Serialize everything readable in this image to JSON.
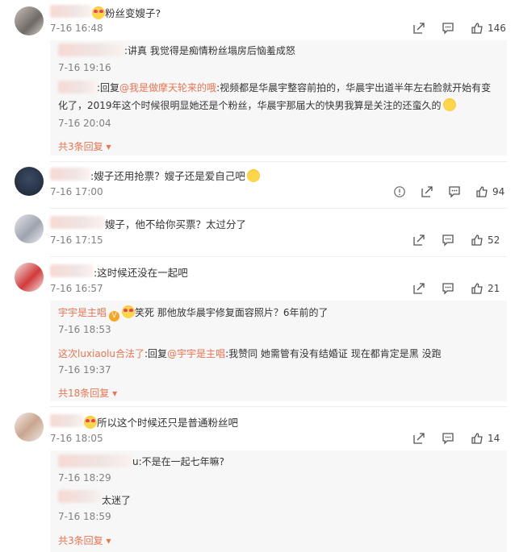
{
  "comments": [
    {
      "text": "粉丝变嫂子?",
      "time": "7-16 16:48",
      "likes": "146",
      "replies": [
        {
          "text": ":讲真 我觉得是痴情粉丝塌房后恼羞成怒",
          "time": "7-16 19:16"
        },
        {
          "prefix": ":回复",
          "mention": "@我是做摩天轮来的哦",
          "text_line1": ":视频都是华晨宇整容前拍的，华晨宇出道半年左右脸就开始有变",
          "text_line2": "化了，2019年这个时候很明显她还是个粉丝，华晨宇那届大的快男我算是关注的还蛮久的",
          "time": "7-16 20:04"
        }
      ],
      "more": "共3条回复"
    },
    {
      "text": ":嫂子还用抢票？嫂子还是爱自己吧",
      "time": "7-16 17:00",
      "likes": "94"
    },
    {
      "text": "嫂子，他不给你买票？太过分了",
      "time": "7-16 17:15",
      "likes": "52"
    },
    {
      "text": ":这时候还没在一起吧",
      "time": "7-16 16:57",
      "likes": "21",
      "replies": [
        {
          "user": "宇宇是主唱",
          "text": "笑死 那他放华晨宇修复面容照片？6年前的了",
          "time": "7-16 18:53"
        },
        {
          "user": "这次luxiaolu合法了",
          "prefix": ":回复",
          "mention": "@宇宇是主唱",
          "text": ":我赞同 她需管有没有结婚证 现在都肯定是黑 没跑",
          "time": "7-16 19:37"
        }
      ],
      "more": "共18条回复"
    },
    {
      "text": "所以这个时候还只是普通粉丝吧",
      "time": "7-16 18:05",
      "likes": "14",
      "replies": [
        {
          "text": "u:不是在一起七年嘛?",
          "time": "7-16 18:29"
        },
        {
          "text": "太迷了",
          "time": "7-16 18:59"
        }
      ],
      "more": "共3条回复"
    }
  ],
  "colors": {
    "accent": "#eb7350",
    "time": "#808080",
    "reply_bg": "#f7f7f7"
  },
  "icons": [
    "share-icon",
    "comment-icon",
    "like-icon",
    "report-icon",
    "chevron-down-icon"
  ]
}
